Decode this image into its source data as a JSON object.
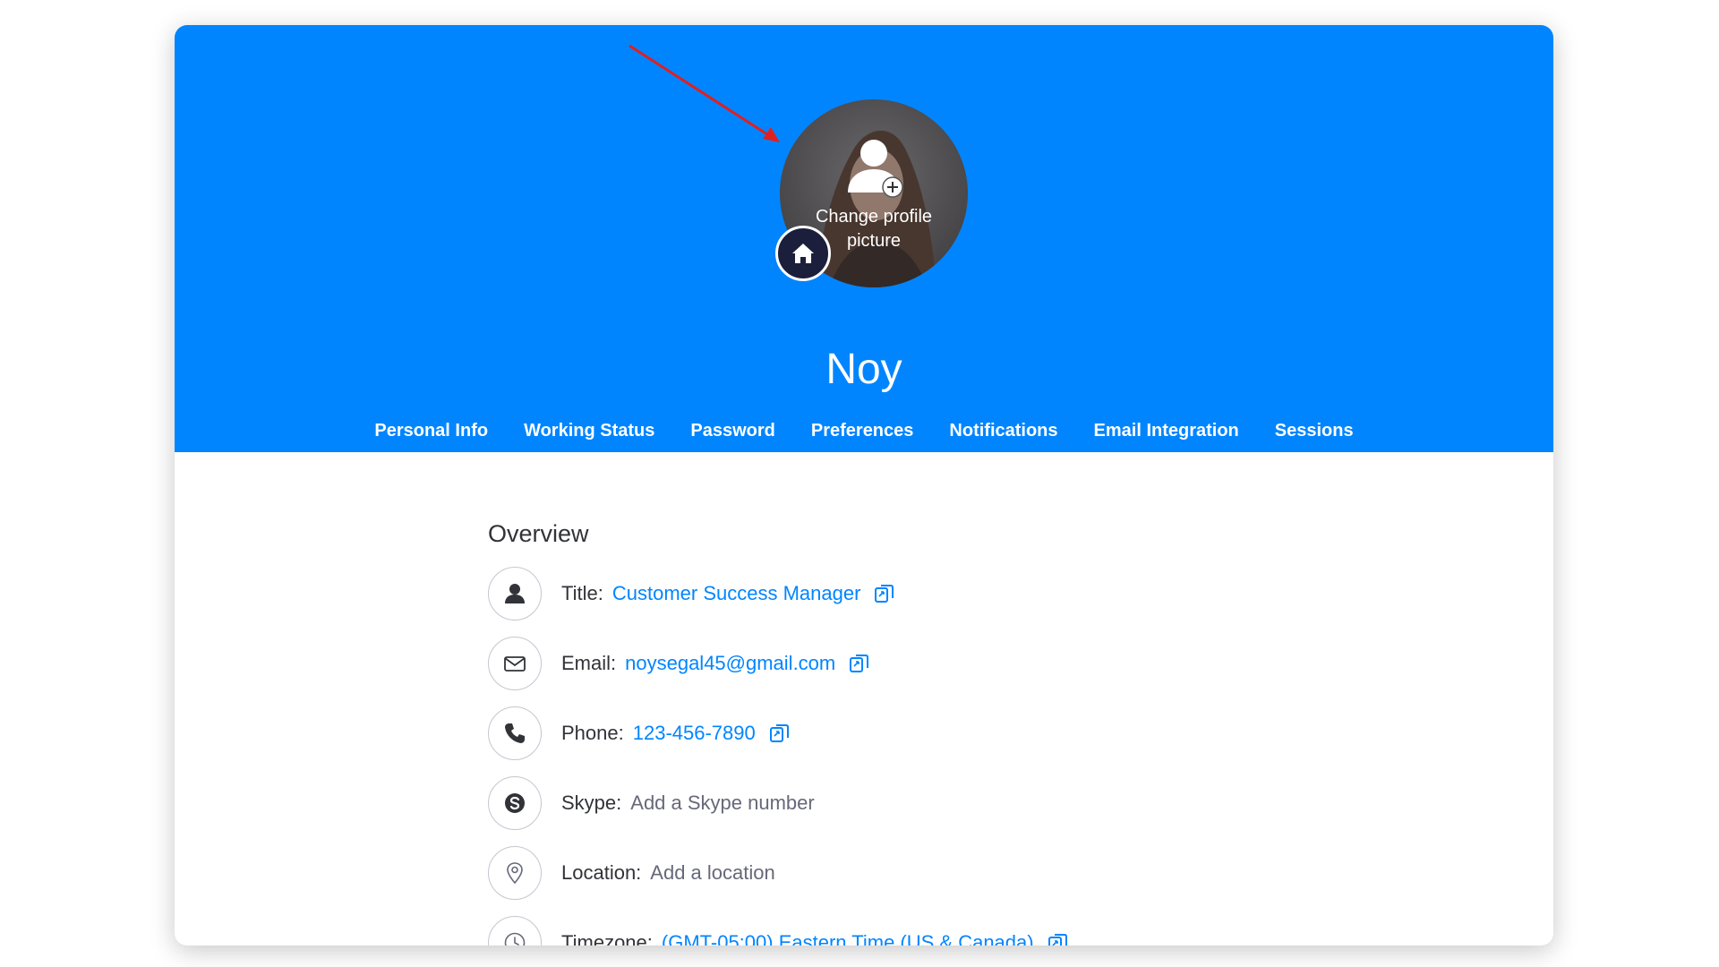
{
  "colors": {
    "header_bg": "#0085ff",
    "link": "#0085ff",
    "text": "#323338",
    "placeholder": "#676879",
    "home_badge": "#1c1f3b",
    "arrow": "#e02020"
  },
  "profile": {
    "avatar_hint": "Change profile picture",
    "name": "Noy"
  },
  "tabs": [
    {
      "label": "Personal Info",
      "active": true
    },
    {
      "label": "Working Status"
    },
    {
      "label": "Password"
    },
    {
      "label": "Preferences"
    },
    {
      "label": "Notifications"
    },
    {
      "label": "Email Integration"
    },
    {
      "label": "Sessions"
    }
  ],
  "overview": {
    "title": "Overview",
    "rows": [
      {
        "icon": "person-icon",
        "label": "Title:",
        "value": "Customer Success Manager",
        "value_type": "link",
        "copyable": true
      },
      {
        "icon": "email-icon",
        "label": "Email:",
        "value": "noysegal45@gmail.com",
        "value_type": "link",
        "copyable": true
      },
      {
        "icon": "phone-icon",
        "label": "Phone:",
        "value": "123-456-7890",
        "value_type": "link",
        "copyable": true
      },
      {
        "icon": "skype-icon",
        "label": "Skype:",
        "value": "Add a Skype number",
        "value_type": "placeholder",
        "copyable": false
      },
      {
        "icon": "location-icon",
        "label": "Location:",
        "value": "Add a location",
        "value_type": "placeholder",
        "copyable": false
      },
      {
        "icon": "clock-icon",
        "label": "Timezone:",
        "value": "(GMT-05:00) Eastern Time (US & Canada)",
        "value_type": "link",
        "copyable": true
      }
    ]
  }
}
